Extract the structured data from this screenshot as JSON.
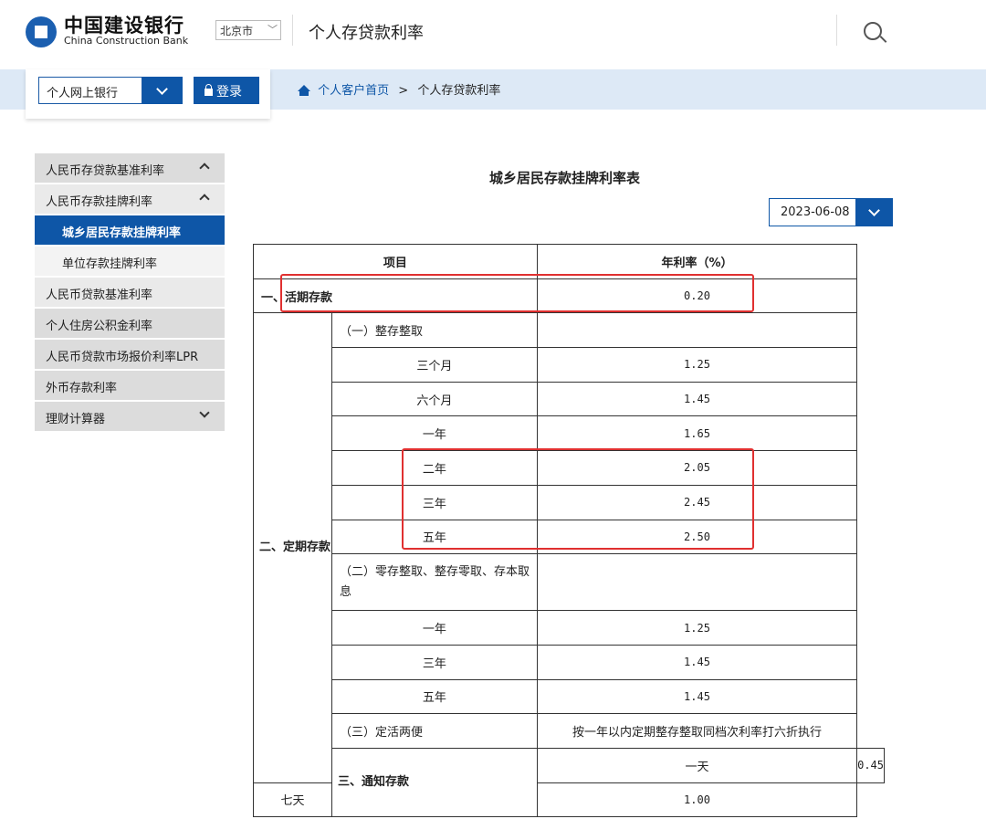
{
  "header": {
    "bank_name_cn": "中国建设银行",
    "bank_name_en": "China Construction Bank",
    "city": "北京市",
    "page_title": "个人存贷款利率"
  },
  "login": {
    "bank_select": "个人网上银行",
    "login_label": "登录"
  },
  "breadcrumb": {
    "home": "个人客户首页",
    "separator": ">",
    "current": "个人存贷款利率"
  },
  "sidebar": {
    "items": [
      {
        "label": "人民币存贷款基准利率"
      },
      {
        "label": "人民币存款挂牌利率"
      },
      {
        "label": "城乡居民存款挂牌利率"
      },
      {
        "label": "单位存款挂牌利率"
      },
      {
        "label": "人民币贷款基准利率"
      },
      {
        "label": "个人住房公积金利率"
      },
      {
        "label": "人民币贷款市场报价利率LPR"
      },
      {
        "label": "外币存款利率"
      },
      {
        "label": "理财计算器"
      }
    ]
  },
  "main": {
    "table_title": "城乡居民存款挂牌利率表",
    "date": "2023-06-08"
  },
  "table": {
    "headers": [
      "项目",
      "年利率（%）"
    ],
    "demand": {
      "label": "一、活期存款",
      "rate": "0.20"
    },
    "fixed": {
      "label": "二、定期存款",
      "whole_label": "（一）整存整取",
      "whole": [
        {
          "term": "三个月",
          "rate": "1.25"
        },
        {
          "term": "六个月",
          "rate": "1.45"
        },
        {
          "term": "一年",
          "rate": "1.65"
        },
        {
          "term": "二年",
          "rate": "2.05"
        },
        {
          "term": "三年",
          "rate": "2.45"
        },
        {
          "term": "五年",
          "rate": "2.50"
        }
      ],
      "installment_label": "（二）零存整取、整存零取、存本取息",
      "installment": [
        {
          "term": "一年",
          "rate": "1.25"
        },
        {
          "term": "三年",
          "rate": "1.45"
        },
        {
          "term": "五年",
          "rate": "1.45"
        }
      ],
      "flexible_label": "（三）定活两便",
      "flexible_rate": "按一年以内定期整存整取同档次利率打六折执行"
    },
    "notice": {
      "label": "三、通知存款",
      "rows": [
        {
          "term": "一天",
          "rate": "0.45"
        },
        {
          "term": "七天",
          "rate": "1.00"
        }
      ]
    }
  },
  "colors": {
    "brand_blue": "#0e56a7",
    "highlight_red": "#e03030"
  }
}
